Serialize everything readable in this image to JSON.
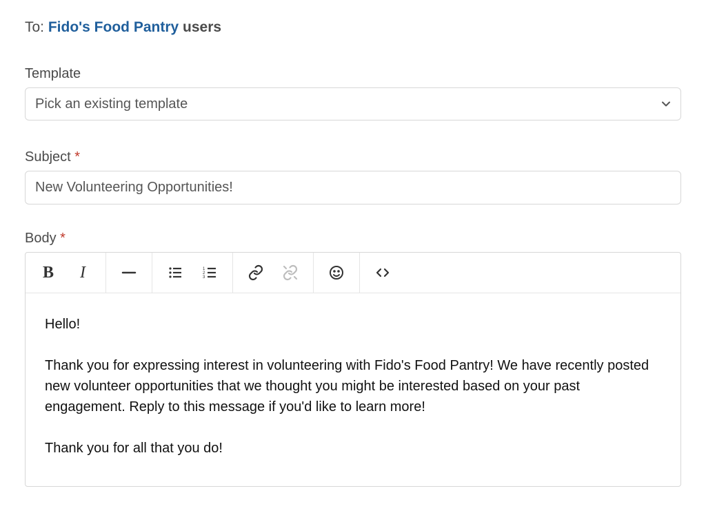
{
  "to": {
    "prefix": "To: ",
    "org": "Fido's Food Pantry",
    "suffix": " users"
  },
  "template": {
    "label": "Template",
    "placeholder": "Pick an existing template"
  },
  "subject": {
    "label": "Subject",
    "required_marker": "*",
    "value": "New Volunteering Opportunities!"
  },
  "body": {
    "label": "Body",
    "required_marker": "*",
    "paragraphs": [
      "Hello!",
      "Thank you for expressing interest in volunteering with Fido's Food Pantry! We have recently posted new volunteer opportunities that we thought you might be interested based on your past engagement. Reply to this message if you'd like to learn more!",
      "Thank you for all that you do!"
    ]
  },
  "toolbar": {
    "bold_glyph": "B",
    "italic_glyph": "I"
  }
}
